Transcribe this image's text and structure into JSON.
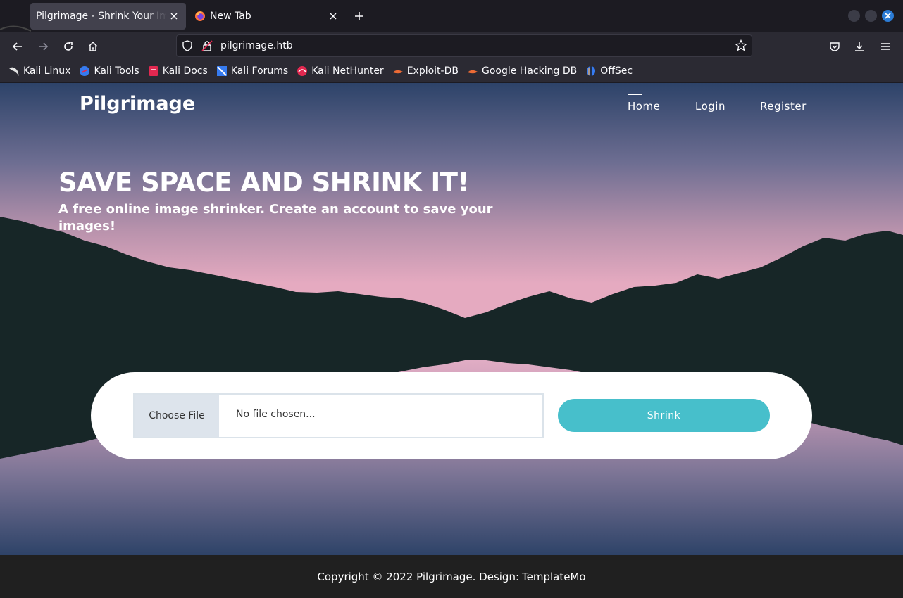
{
  "browser": {
    "tabs": [
      {
        "title": "Pilgrimage - Shrink Your Images",
        "active": true
      },
      {
        "title": "New Tab",
        "active": false
      }
    ],
    "url": "pilgrimage.htb",
    "bookmarks": [
      {
        "label": "Kali Linux",
        "icon": "kali-dragon-icon"
      },
      {
        "label": "Kali Tools",
        "icon": "kali-tools-icon"
      },
      {
        "label": "Kali Docs",
        "icon": "kali-docs-icon"
      },
      {
        "label": "Kali Forums",
        "icon": "kali-forums-icon"
      },
      {
        "label": "Kali NetHunter",
        "icon": "kali-nethunter-icon"
      },
      {
        "label": "Exploit-DB",
        "icon": "exploit-db-icon"
      },
      {
        "label": "Google Hacking DB",
        "icon": "ghdb-icon"
      },
      {
        "label": "OffSec",
        "icon": "offsec-icon"
      }
    ]
  },
  "site": {
    "brand": "Pilgrimage",
    "nav": {
      "home": "Home",
      "login": "Login",
      "register": "Register"
    },
    "hero": {
      "headline": "SAVE SPACE AND SHRINK IT!",
      "subline": "A free online image shrinker. Create an account to save your images!"
    },
    "upload": {
      "choose_label": "Choose File",
      "file_status": "No file chosen...",
      "submit_label": "Shrink"
    },
    "footer": {
      "text": "Copyright © 2022 Pilgrimage. Design:",
      "link": "TemplateMo"
    }
  },
  "colors": {
    "accent": "#47bfcb",
    "sky_top": "#2e4368",
    "sky_pink": "#e3a9be",
    "mountain": "#172627",
    "footer": "#202020"
  }
}
